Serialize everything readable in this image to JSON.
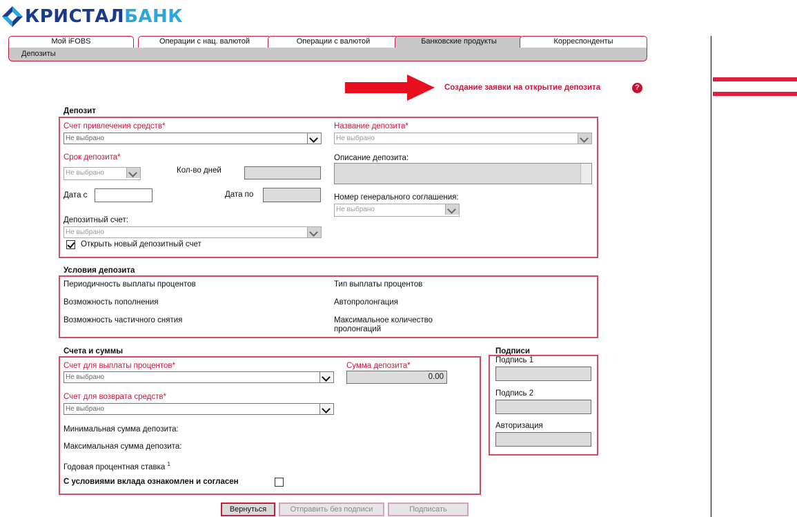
{
  "logo": {
    "part1": "КРИСТАЛ",
    "part2": "БАНК"
  },
  "tabs": [
    {
      "label": "Мой iFOBS"
    },
    {
      "label": "Операции с нац. валютой"
    },
    {
      "label": "Операции с валютой"
    },
    {
      "label": "Банковские продукты"
    },
    {
      "label": "Корреспонденты"
    }
  ],
  "subnav": {
    "label": "Депозиты"
  },
  "heading": {
    "title": "Создание заявки на открытие депозита",
    "help": "?"
  },
  "deposit": {
    "section_title": "Депозит",
    "funding_account_label": "Счет привлечения средств",
    "funding_account_value": "Не выбрано",
    "deposit_name_label": "Название депозита",
    "deposit_name_value": "Не выбрано",
    "term_label": "Срок депозита",
    "term_value": "Не выбрано",
    "days_label": "Кол-во дней",
    "date_from_label": "Дата с",
    "date_to_label": "Дата по",
    "description_label": "Описание депозита:",
    "agreement_label": "Номер генерального соглашения:",
    "agreement_value": "Не выбрано",
    "deposit_account_label": "Депозитный счет:",
    "deposit_account_value": "Не выбрано",
    "open_new_label": "Открыть новый депозитный счет",
    "required_mark": "*"
  },
  "conditions": {
    "section_title": "Условия депозита",
    "interest_frequency": "Периодичность выплаты процентов",
    "interest_type": "Тип выплаты процентов",
    "replenishment": "Возможность пополнения",
    "auto_prolong": "Автопролонгация",
    "partial_withdrawal": "Возможность частичного снятия",
    "max_prolong_line1": "Максимальное количество",
    "max_prolong_line2": "пролонгаций"
  },
  "accounts": {
    "section_title": "Счета и суммы",
    "interest_account_label": "Счет для выплаты процентов",
    "interest_account_value": "Не выбрано",
    "deposit_sum_label": "Сумма депозита",
    "deposit_sum_value": "0.00",
    "return_account_label": "Счет для возврата средств",
    "return_account_value": "Не выбрано",
    "min_sum_label": "Минимальная сумма депозита:",
    "max_sum_label": "Максимальная сумма депозита:",
    "rate_label": "Годовая процентная ставка",
    "rate_footnote": "1",
    "agree_label": "С условиями вклада ознакомлен и согласен"
  },
  "signatures": {
    "section_title": "Подписи",
    "sig1": "Подпись 1",
    "sig2": "Подпись 2",
    "auth": "Авторизация"
  },
  "buttons": {
    "back": "Вернуться",
    "send_unsigned": "Отправить без подписи",
    "sign": "Подписать"
  },
  "colors": {
    "accent": "#d3143c",
    "brand_dark": "#1a3a8c",
    "brand_light": "#2ba6de",
    "tab_active": "#c8c8c8"
  }
}
